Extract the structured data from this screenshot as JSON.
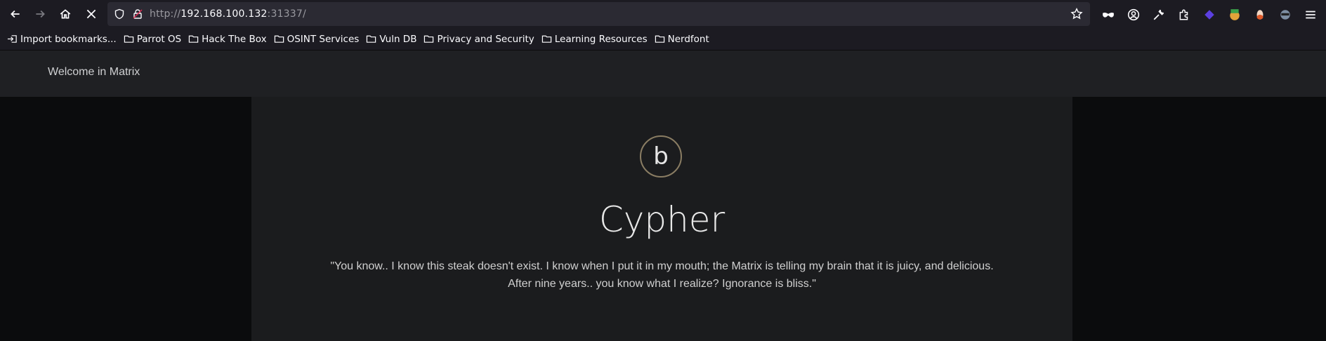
{
  "browser": {
    "url_scheme": "http://",
    "url_host": "192.168.100.132",
    "url_port": ":31337/",
    "nav_icons": [
      "back-icon",
      "forward-icon",
      "home-icon",
      "stop-icon"
    ],
    "extension_icons": [
      "mask-icon",
      "account-icon",
      "wrench-icon",
      "puzzle-icon",
      "extension-icon",
      "extension-icon",
      "extension-icon",
      "extension-icon",
      "menu-icon"
    ]
  },
  "bookmarks": [
    {
      "label": "Import bookmarks...",
      "icon": "import-icon"
    },
    {
      "label": "Parrot OS",
      "icon": "folder-icon"
    },
    {
      "label": "Hack The Box",
      "icon": "folder-icon"
    },
    {
      "label": "OSINT Services",
      "icon": "folder-icon"
    },
    {
      "label": "Vuln DB",
      "icon": "folder-icon"
    },
    {
      "label": "Privacy and Security",
      "icon": "folder-icon"
    },
    {
      "label": "Learning Resources",
      "icon": "folder-icon"
    },
    {
      "label": "Nerdfont",
      "icon": "folder-icon"
    }
  ],
  "page": {
    "brand": "Welcome in Matrix",
    "avatar_letter": "b",
    "title": "Cypher",
    "quote_line1": "\"You know.. I know this steak doesn't exist. I know when I put it in my mouth; the Matrix is telling my brain that it is juicy, and delicious.",
    "quote_line2": "After nine years.. you know what I realize? Ignorance is bliss.\""
  }
}
